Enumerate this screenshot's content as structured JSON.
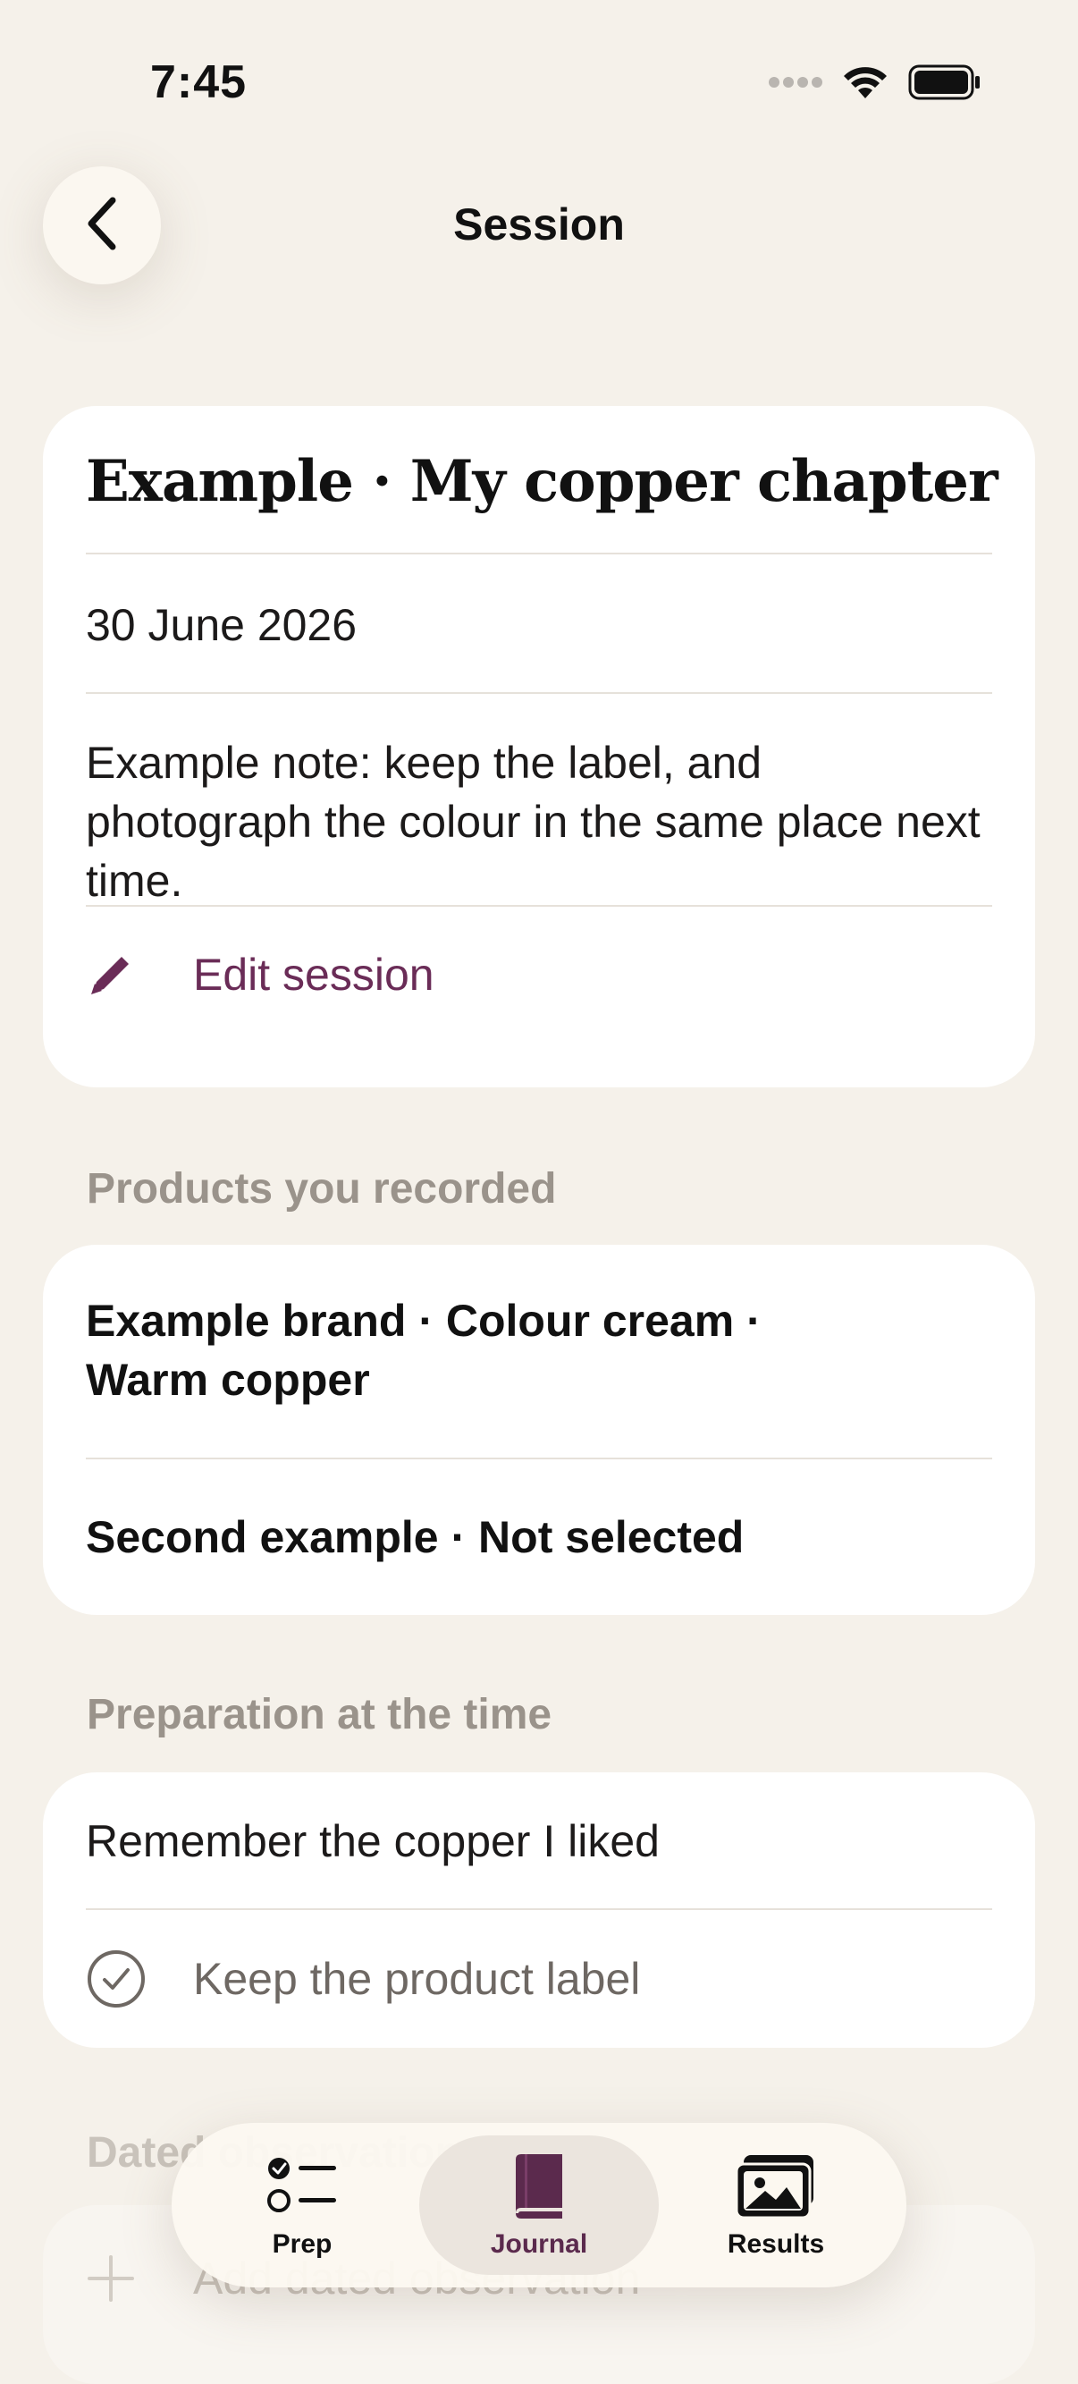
{
  "status_bar": {
    "time": "7:45"
  },
  "nav": {
    "title": "Session"
  },
  "session": {
    "title": "Example · My copper chapter",
    "date": "30 June 2026",
    "note": "Example note: keep the label, and photograph the colour in the same place next time.",
    "edit_label": "Edit session"
  },
  "products": {
    "section_label": "Products you recorded",
    "items": [
      {
        "label": "Example brand · Colour cream · Warm copper"
      },
      {
        "label": "Second example · Not selected"
      }
    ]
  },
  "preparation": {
    "section_label": "Preparation at the time",
    "note": "Remember the copper I liked",
    "checklist": [
      {
        "label": "Keep the product label",
        "checked": true
      }
    ]
  },
  "dated_observations": {
    "section_label": "Dated observations",
    "add_label": "Add dated observation"
  },
  "tab_bar": {
    "tabs": [
      {
        "label": "Prep",
        "icon": "checklist-icon",
        "active": false
      },
      {
        "label": "Journal",
        "icon": "book-icon",
        "active": true
      },
      {
        "label": "Results",
        "icon": "photos-icon",
        "active": false
      }
    ]
  },
  "colors": {
    "background": "#f5f1ea",
    "accent": "#6a2c57",
    "card": "#ffffff",
    "secondary_text": "#9a938b"
  }
}
